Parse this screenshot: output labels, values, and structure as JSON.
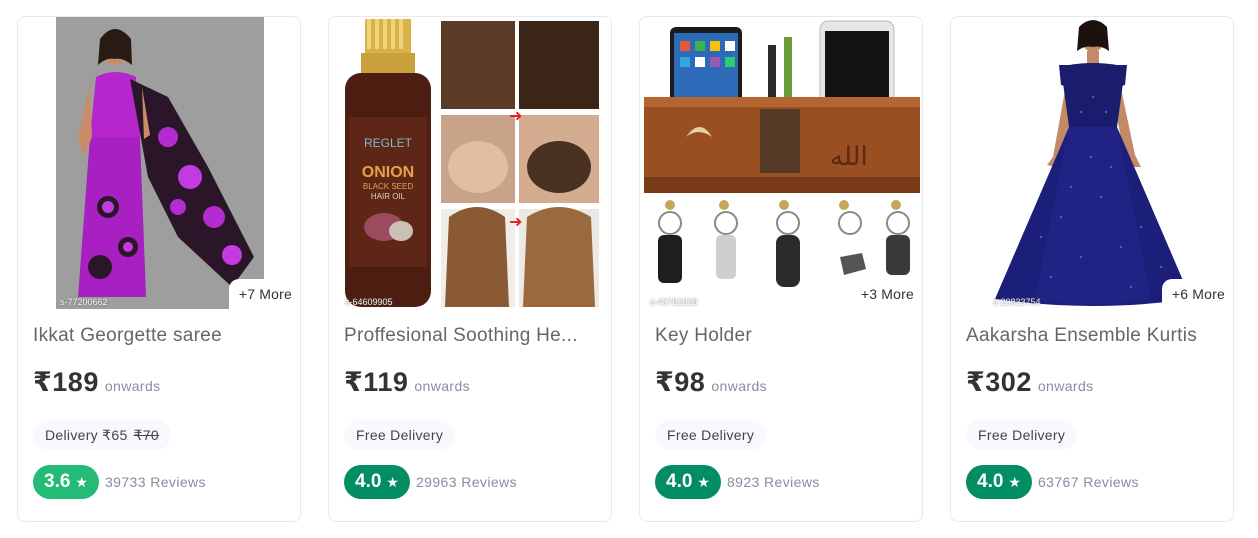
{
  "products": [
    {
      "title": "Ikkat Georgette saree",
      "price": "₹189",
      "onwards": "onwards",
      "delivery": "Delivery ₹65",
      "delivery_strike": "₹70",
      "rating": "3.6",
      "rating_color": "#23bb75",
      "reviews": "39733 Reviews",
      "more": "+7 More",
      "sku": "s-77200662"
    },
    {
      "title": "Proffesional Soothing He...",
      "price": "₹119",
      "onwards": "onwards",
      "delivery": "Free Delivery",
      "rating": "4.0",
      "rating_color": "#038d63",
      "reviews": "29963 Reviews",
      "sku": "s-64609905",
      "product_brand": "REGLET",
      "product_name_1": "ONION",
      "product_name_2": "BLACK SEED",
      "product_name_3": "HAIR OIL"
    },
    {
      "title": "Key Holder",
      "price": "₹98",
      "onwards": "onwards",
      "delivery": "Free Delivery",
      "rating": "4.0",
      "rating_color": "#038d63",
      "reviews": "8923 Reviews",
      "more": "+3 More",
      "sku": "s-43782628"
    },
    {
      "title": "Aakarsha Ensemble Kurtis",
      "price": "₹302",
      "onwards": "onwards",
      "delivery": "Free Delivery",
      "rating": "4.0",
      "rating_color": "#038d63",
      "reviews": "63767 Reviews",
      "more": "+6 More",
      "sku": "s-20833754"
    }
  ]
}
